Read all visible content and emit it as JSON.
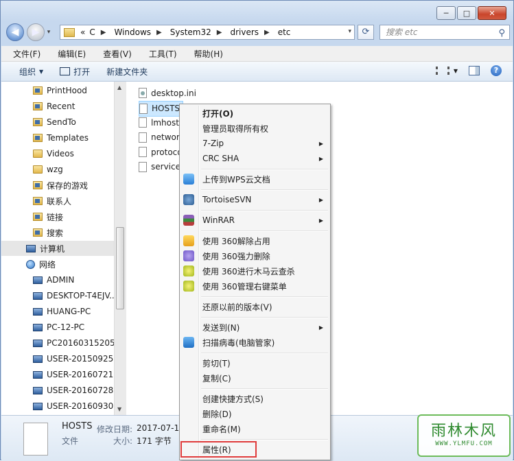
{
  "window": {
    "caption": {
      "minimize": "─",
      "maximize": "□",
      "close": "✕"
    }
  },
  "nav": {
    "back_glyph": "◀",
    "forward_glyph": "▶",
    "history_drop": "▾",
    "address": {
      "overflow": "«",
      "segments": [
        "C",
        "Windows",
        "System32",
        "drivers",
        "etc"
      ],
      "separator": "▶"
    },
    "refresh_glyph": "⟳",
    "search": {
      "placeholder": "搜索 etc",
      "icon": "search-icon"
    }
  },
  "menubar": [
    "文件(F)",
    "编辑(E)",
    "查看(V)",
    "工具(T)",
    "帮助(H)"
  ],
  "toolbar": {
    "organize": "组织",
    "open": "打开",
    "new_folder": "新建文件夹"
  },
  "navpane": {
    "items": [
      {
        "label": "PrintHood",
        "icon": "special"
      },
      {
        "label": "Recent",
        "icon": "special"
      },
      {
        "label": "SendTo",
        "icon": "special"
      },
      {
        "label": "Templates",
        "icon": "special"
      },
      {
        "label": "Videos",
        "icon": "folder"
      },
      {
        "label": "wzg",
        "icon": "folder"
      },
      {
        "label": "保存的游戏",
        "icon": "special"
      },
      {
        "label": "联系人",
        "icon": "special"
      },
      {
        "label": "链接",
        "icon": "special"
      },
      {
        "label": "搜索",
        "icon": "special"
      },
      {
        "label": "计算机",
        "icon": "computer"
      },
      {
        "label": "网络",
        "icon": "network"
      },
      {
        "label": "ADMIN",
        "icon": "computer"
      },
      {
        "label": "DESKTOP-T4EJV...",
        "icon": "computer"
      },
      {
        "label": "HUANG-PC",
        "icon": "computer"
      },
      {
        "label": "PC-12-PC",
        "icon": "computer"
      },
      {
        "label": "PC20160315205...",
        "icon": "computer"
      },
      {
        "label": "USER-20150925...",
        "icon": "computer"
      },
      {
        "label": "USER-20160721...",
        "icon": "computer"
      },
      {
        "label": "USER-20160728...",
        "icon": "computer"
      },
      {
        "label": "USER-20160930...",
        "icon": "computer"
      }
    ]
  },
  "files": [
    {
      "name": "desktop.ini"
    },
    {
      "name": "HOSTS"
    },
    {
      "name": "lmhosts.sam"
    },
    {
      "name": "networks"
    },
    {
      "name": "protocol"
    },
    {
      "name": "services"
    }
  ],
  "details": {
    "name": "HOSTS",
    "modified_label": "修改日期:",
    "modified_value": "2017-07-13 ...",
    "type": "文件",
    "size_label": "大小:",
    "size_value": "171 字节"
  },
  "context_menu": {
    "open": "打开(O)",
    "take_ownership": "管理员取得所有权",
    "zip": "7-Zip",
    "crc": "CRC SHA",
    "wps": "上传到WPS云文档",
    "svn": "TortoiseSVN",
    "winrar": "WinRAR",
    "unlock360": "使用 360解除占用",
    "delete360": "使用 360强力删除",
    "scan360": "使用 360进行木马云查杀",
    "manage360": "使用 360管理右键菜单",
    "restore": "还原以前的版本(V)",
    "sendto": "发送到(N)",
    "virus": "扫描病毒(电脑管家)",
    "cut": "剪切(T)",
    "copy": "复制(C)",
    "shortcut": "创建快捷方式(S)",
    "delete": "删除(D)",
    "rename": "重命名(M)",
    "properties": "属性(R)",
    "submenu_glyph": "▶"
  },
  "watermark": {
    "title": "雨林木风",
    "url": "WWW.YLMFU.COM"
  }
}
